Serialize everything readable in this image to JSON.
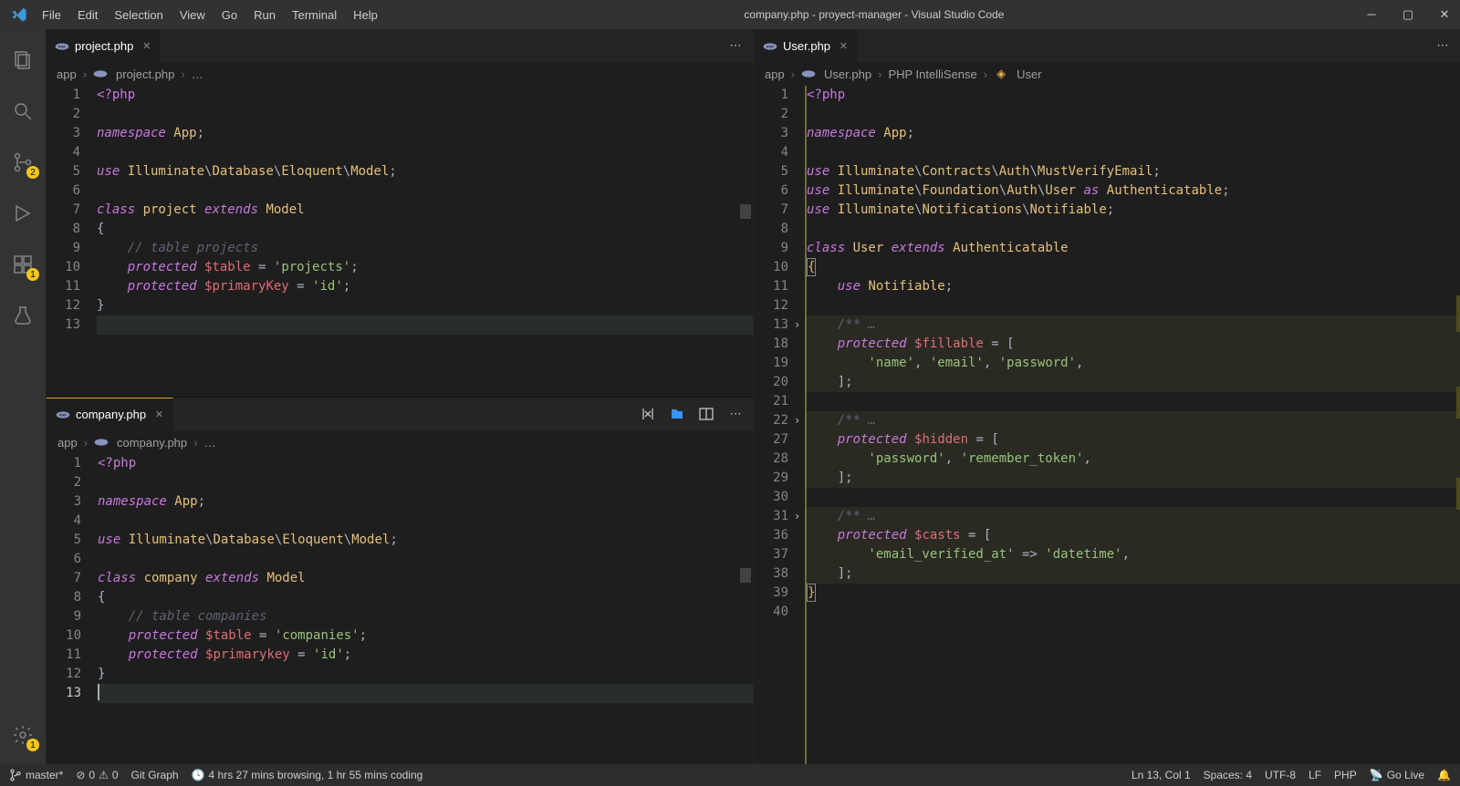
{
  "titlebar": {
    "title": "company.php - proyect-manager - Visual Studio Code",
    "menu": [
      "File",
      "Edit",
      "Selection",
      "View",
      "Go",
      "Run",
      "Terminal",
      "Help"
    ]
  },
  "activity": {
    "scm_badge": "2",
    "ext_badge": "1",
    "gear_badge": "1"
  },
  "panes": {
    "tl": {
      "tab": "project.php",
      "breadcrumbs": [
        "app",
        "project.php",
        "…"
      ],
      "lines": [
        "1",
        "2",
        "3",
        "4",
        "5",
        "6",
        "7",
        "8",
        "9",
        "10",
        "11",
        "12",
        "13"
      ],
      "code": {
        "l1a": "<?php",
        "l3a": "namespace ",
        "l3b": "App",
        "l3c": ";",
        "l5a": "use ",
        "l5b": "Illuminate",
        "l5c": "\\",
        "l5d": "Database",
        "l5e": "\\",
        "l5f": "Eloquent",
        "l5g": "\\",
        "l5h": "Model",
        "l5i": ";",
        "l7a": "class ",
        "l7b": "project ",
        "l7c": "extends ",
        "l7d": "Model",
        "l8": "{",
        "l9a": "    // table projects",
        "l10a": "    protected ",
        "l10b": "$table",
        "l10c": " = ",
        "l10d": "'projects'",
        "l10e": ";",
        "l11a": "    protected ",
        "l11b": "$primaryKey",
        "l11c": " = ",
        "l11d": "'id'",
        "l11e": ";",
        "l12": "}"
      }
    },
    "bl": {
      "tab": "company.php",
      "breadcrumbs": [
        "app",
        "company.php",
        "…"
      ],
      "lines": [
        "1",
        "2",
        "3",
        "4",
        "5",
        "6",
        "7",
        "8",
        "9",
        "10",
        "11",
        "12",
        "13"
      ],
      "code": {
        "l1a": "<?php",
        "l3a": "namespace ",
        "l3b": "App",
        "l3c": ";",
        "l5a": "use ",
        "l5b": "Illuminate",
        "l5c": "\\",
        "l5d": "Database",
        "l5e": "\\",
        "l5f": "Eloquent",
        "l5g": "\\",
        "l5h": "Model",
        "l5i": ";",
        "l7a": "class ",
        "l7b": "company ",
        "l7c": "extends ",
        "l7d": "Model",
        "l8": "{",
        "l9a": "    // table companies",
        "l10a": "    protected ",
        "l10b": "$table",
        "l10c": " = ",
        "l10d": "'companies'",
        "l10e": ";",
        "l11a": "    protected ",
        "l11b": "$primarykey",
        "l11c": " = ",
        "l11d": "'id'",
        "l11e": ";",
        "l12": "}"
      }
    },
    "r": {
      "tab": "User.php",
      "breadcrumbs": [
        "app",
        "User.php",
        "PHP IntelliSense",
        "User"
      ],
      "lines": [
        "1",
        "2",
        "3",
        "4",
        "5",
        "6",
        "7",
        "8",
        "9",
        "10",
        "11",
        "12",
        "13",
        "18",
        "19",
        "20",
        "21",
        "22",
        "27",
        "28",
        "29",
        "30",
        "31",
        "36",
        "37",
        "38",
        "39",
        "40"
      ],
      "code": {
        "l1a": "<?php",
        "l3a": "namespace ",
        "l3b": "App",
        "l3c": ";",
        "l5a": "use ",
        "l5b": "Illuminate",
        "l5c": "\\",
        "l5d": "Contracts",
        "l5e": "\\",
        "l5f": "Auth",
        "l5g": "\\",
        "l5h": "MustVerifyEmail",
        "l5i": ";",
        "l6a": "use ",
        "l6b": "Illuminate",
        "l6c": "\\",
        "l6d": "Foundation",
        "l6e": "\\",
        "l6f": "Auth",
        "l6g": "\\",
        "l6h": "User",
        "l6i": " as ",
        "l6j": "Authenticatable",
        "l6k": ";",
        "l7a": "use ",
        "l7b": "Illuminate",
        "l7c": "\\",
        "l7d": "Notifications",
        "l7e": "\\",
        "l7f": "Notifiable",
        "l7g": ";",
        "l9a": "class ",
        "l9b": "User ",
        "l9c": "extends ",
        "l9d": "Authenticatable",
        "l10": "{",
        "l11a": "    use ",
        "l11b": "Notifiable",
        "l11c": ";",
        "l13": "    /** …",
        "l18a": "    protected ",
        "l18b": "$fillable",
        "l18c": " = [",
        "l19a": "        'name'",
        "l19b": ", ",
        "l19c": "'email'",
        "l19d": ", ",
        "l19e": "'password'",
        "l19f": ",",
        "l20": "    ];",
        "l22": "    /** …",
        "l27a": "    protected ",
        "l27b": "$hidden",
        "l27c": " = [",
        "l28a": "        'password'",
        "l28b": ", ",
        "l28c": "'remember_token'",
        "l28d": ",",
        "l29": "    ];",
        "l31": "    /** …",
        "l36a": "    protected ",
        "l36b": "$casts",
        "l36c": " = [",
        "l37a": "        'email_verified_at'",
        "l37b": " => ",
        "l37c": "'datetime'",
        "l37d": ",",
        "l38": "    ];",
        "l39": "}"
      }
    }
  },
  "status": {
    "branch": "master*",
    "errors": "0",
    "warnings": "0",
    "gitgraph": "Git Graph",
    "time": "4 hrs 27 mins browsing, 1 hr 55 mins coding",
    "pos": "Ln 13, Col 1",
    "spaces": "Spaces: 4",
    "enc": "UTF-8",
    "eol": "LF",
    "lang": "PHP",
    "golive": "Go Live"
  }
}
